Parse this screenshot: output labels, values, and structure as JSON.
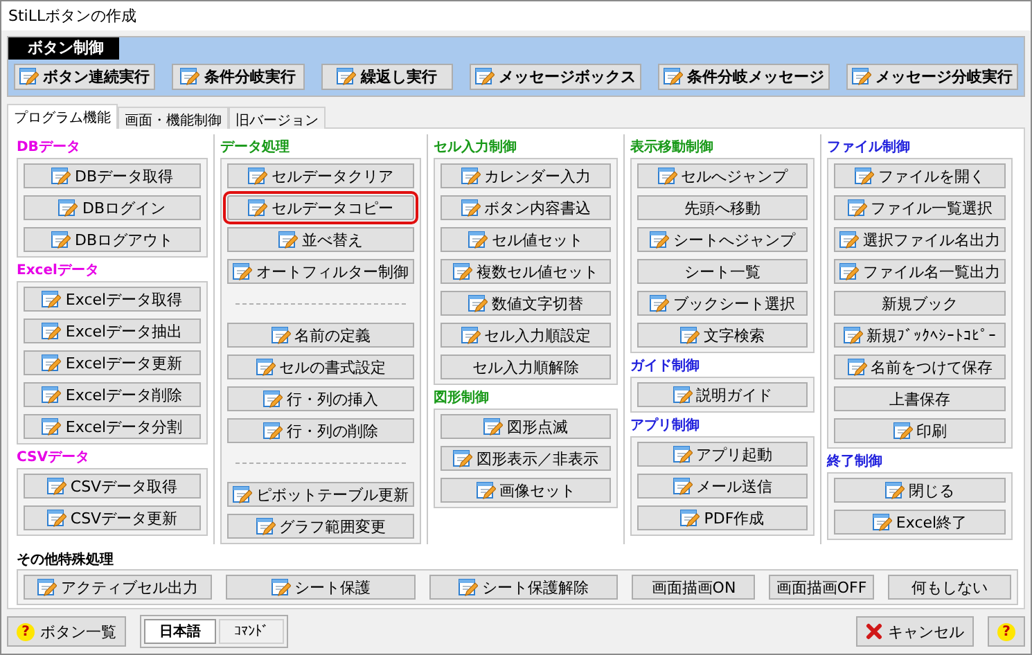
{
  "window": {
    "title": "StiLLボタンの作成"
  },
  "button_control": {
    "title": "ボタン制御",
    "buttons": [
      {
        "label": "ボタン連続実行",
        "icon": true
      },
      {
        "label": "条件分岐実行",
        "icon": true
      },
      {
        "label": "繰返し実行",
        "icon": true
      },
      {
        "label": "メッセージボックス",
        "icon": true
      },
      {
        "label": "条件分岐メッセージ",
        "icon": true
      },
      {
        "label": "メッセージ分岐実行",
        "icon": true
      }
    ]
  },
  "tabs": [
    {
      "label": "プログラム機能",
      "selected": true
    },
    {
      "label": "画面・機能制御",
      "selected": false
    },
    {
      "label": "旧バージョン",
      "selected": false
    }
  ],
  "columns": [
    {
      "groups": [
        {
          "title": "DBデータ",
          "color": "#e600e6",
          "items": [
            {
              "kind": "button",
              "label": "DBデータ取得",
              "icon": true,
              "highlighted": false
            },
            {
              "kind": "button",
              "label": "DBログイン",
              "icon": true,
              "highlighted": false
            },
            {
              "kind": "button",
              "label": "DBログアウト",
              "icon": true,
              "highlighted": false
            }
          ]
        },
        {
          "title": "Excelデータ",
          "color": "#e600e6",
          "items": [
            {
              "kind": "button",
              "label": "Excelデータ取得",
              "icon": true,
              "highlighted": false
            },
            {
              "kind": "button",
              "label": "Excelデータ抽出",
              "icon": true,
              "highlighted": false
            },
            {
              "kind": "button",
              "label": "Excelデータ更新",
              "icon": true,
              "highlighted": false
            },
            {
              "kind": "button",
              "label": "Excelデータ削除",
              "icon": true,
              "highlighted": false
            },
            {
              "kind": "button",
              "label": "Excelデータ分割",
              "icon": true,
              "highlighted": false
            }
          ]
        },
        {
          "title": "CSVデータ",
          "color": "#e600e6",
          "items": [
            {
              "kind": "button",
              "label": "CSVデータ取得",
              "icon": true,
              "highlighted": false
            },
            {
              "kind": "button",
              "label": "CSVデータ更新",
              "icon": true,
              "highlighted": false
            }
          ]
        }
      ]
    },
    {
      "groups": [
        {
          "title": "データ処理",
          "color": "#1a9a1a",
          "items": [
            {
              "kind": "button",
              "label": "セルデータクリア",
              "icon": true,
              "highlighted": false
            },
            {
              "kind": "button",
              "label": "セルデータコピー",
              "icon": true,
              "highlighted": true
            },
            {
              "kind": "button",
              "label": "並べ替え",
              "icon": true,
              "highlighted": false
            },
            {
              "kind": "button",
              "label": "オートフィルター制御",
              "icon": true,
              "highlighted": false
            },
            {
              "kind": "separator"
            },
            {
              "kind": "button",
              "label": "名前の定義",
              "icon": true,
              "highlighted": false
            },
            {
              "kind": "button",
              "label": "セルの書式設定",
              "icon": true,
              "highlighted": false
            },
            {
              "kind": "button",
              "label": "行・列の挿入",
              "icon": true,
              "highlighted": false
            },
            {
              "kind": "button",
              "label": "行・列の削除",
              "icon": true,
              "highlighted": false
            },
            {
              "kind": "separator"
            },
            {
              "kind": "button",
              "label": "ピボットテーブル更新",
              "icon": true,
              "highlighted": false
            },
            {
              "kind": "button",
              "label": "グラフ範囲変更",
              "icon": true,
              "highlighted": false
            }
          ]
        }
      ]
    },
    {
      "groups": [
        {
          "title": "セル入力制御",
          "color": "#1a9a1a",
          "items": [
            {
              "kind": "button",
              "label": "カレンダー入力",
              "icon": true,
              "highlighted": false
            },
            {
              "kind": "button",
              "label": "ボタン内容書込",
              "icon": true,
              "highlighted": false
            },
            {
              "kind": "button",
              "label": "セル値セット",
              "icon": true,
              "highlighted": false
            },
            {
              "kind": "button",
              "label": "複数セル値セット",
              "icon": true,
              "highlighted": false
            },
            {
              "kind": "button",
              "label": "数値文字切替",
              "icon": true,
              "highlighted": false
            },
            {
              "kind": "button",
              "label": "セル入力順設定",
              "icon": true,
              "highlighted": false
            },
            {
              "kind": "button",
              "label": "セル入力順解除",
              "icon": false,
              "highlighted": false
            }
          ]
        },
        {
          "title": "図形制御",
          "color": "#1a9a1a",
          "items": [
            {
              "kind": "button",
              "label": "図形点滅",
              "icon": true,
              "highlighted": false
            },
            {
              "kind": "button",
              "label": "図形表示／非表示",
              "icon": true,
              "highlighted": false
            },
            {
              "kind": "button",
              "label": "画像セット",
              "icon": true,
              "highlighted": false
            }
          ]
        }
      ]
    },
    {
      "groups": [
        {
          "title": "表示移動制御",
          "color": "#1a9a1a",
          "items": [
            {
              "kind": "button",
              "label": "セルへジャンプ",
              "icon": true,
              "highlighted": false
            },
            {
              "kind": "button",
              "label": "先頭へ移動",
              "icon": false,
              "highlighted": false
            },
            {
              "kind": "button",
              "label": "シートへジャンプ",
              "icon": true,
              "highlighted": false
            },
            {
              "kind": "button",
              "label": "シート一覧",
              "icon": false,
              "highlighted": false
            },
            {
              "kind": "button",
              "label": "ブックシート選択",
              "icon": true,
              "highlighted": false
            },
            {
              "kind": "button",
              "label": "文字検索",
              "icon": true,
              "highlighted": false
            }
          ]
        },
        {
          "title": "ガイド制御",
          "color": "#2222dd",
          "items": [
            {
              "kind": "button",
              "label": "説明ガイド",
              "icon": true,
              "highlighted": false
            }
          ]
        },
        {
          "title": "アプリ制御",
          "color": "#2222dd",
          "items": [
            {
              "kind": "button",
              "label": "アプリ起動",
              "icon": true,
              "highlighted": false
            },
            {
              "kind": "button",
              "label": "メール送信",
              "icon": true,
              "highlighted": false
            },
            {
              "kind": "button",
              "label": "PDF作成",
              "icon": true,
              "highlighted": false
            }
          ]
        }
      ]
    },
    {
      "groups": [
        {
          "title": "ファイル制御",
          "color": "#2222dd",
          "items": [
            {
              "kind": "button",
              "label": "ファイルを開く",
              "icon": true,
              "highlighted": false
            },
            {
              "kind": "button",
              "label": "ファイル一覧選択",
              "icon": true,
              "highlighted": false
            },
            {
              "kind": "button",
              "label": "選択ファイル名出力",
              "icon": true,
              "highlighted": false
            },
            {
              "kind": "button",
              "label": "ファイル名一覧出力",
              "icon": true,
              "highlighted": false
            },
            {
              "kind": "button",
              "label": "新規ブック",
              "icon": false,
              "highlighted": false
            },
            {
              "kind": "button",
              "label": "新規ﾌﾞｯｸﾍｼｰﾄｺﾋﾟｰ",
              "icon": true,
              "highlighted": false
            },
            {
              "kind": "button",
              "label": "名前をつけて保存",
              "icon": true,
              "highlighted": false
            },
            {
              "kind": "button",
              "label": "上書保存",
              "icon": false,
              "highlighted": false
            },
            {
              "kind": "button",
              "label": "印刷",
              "icon": true,
              "highlighted": false
            }
          ]
        },
        {
          "title": "終了制御",
          "color": "#2222dd",
          "items": [
            {
              "kind": "button",
              "label": "閉じる",
              "icon": true,
              "highlighted": false
            },
            {
              "kind": "button",
              "label": "Excel終了",
              "icon": true,
              "highlighted": false
            }
          ]
        }
      ]
    }
  ],
  "special": {
    "title": "その他特殊処理",
    "buttons": [
      {
        "label": "アクティブセル出力",
        "icon": true
      },
      {
        "label": "シート保護",
        "icon": true
      },
      {
        "label": "シート保護解除",
        "icon": true
      },
      {
        "label": "画面描画ON",
        "icon": false
      },
      {
        "label": "画面描画OFF",
        "icon": false
      },
      {
        "label": "何もしない",
        "icon": false
      }
    ]
  },
  "footer": {
    "list_button": {
      "mark": "?",
      "label": "ボタン一覧"
    },
    "languages": [
      {
        "label": "日本語",
        "selected": true
      },
      {
        "label": "ｺﾏﾝﾄﾞ",
        "selected": false
      }
    ],
    "cancel_button": "キャンセル",
    "help_button": {
      "mark": "?"
    }
  }
}
